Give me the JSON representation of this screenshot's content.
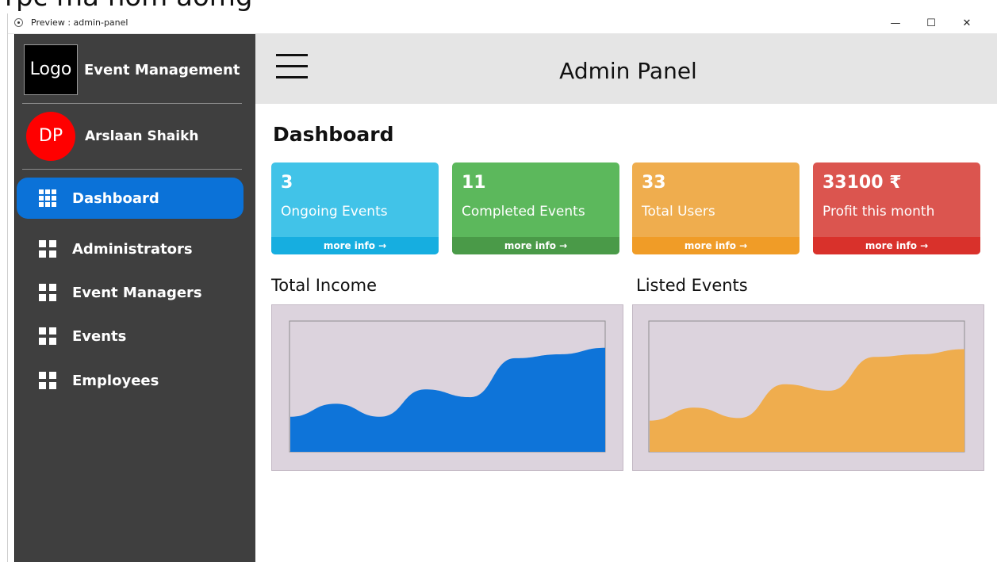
{
  "top_caption": "rpc ma nom aomg",
  "window": {
    "title": "Preview : admin-panel",
    "minimize": "—",
    "maximize": "☐",
    "close": "✕"
  },
  "brand": {
    "logo": "Logo",
    "name": "Event Management"
  },
  "profile": {
    "initials": "DP",
    "name": "Arslaan Shaikh"
  },
  "nav": [
    {
      "label": "Dashboard",
      "icon": "grid-9-icon",
      "active": true
    },
    {
      "label": "Administrators",
      "icon": "grid-4-icon",
      "active": false
    },
    {
      "label": "Event Managers",
      "icon": "grid-4-icon",
      "active": false
    },
    {
      "label": "Events",
      "icon": "grid-4-icon",
      "active": false
    },
    {
      "label": "Employees",
      "icon": "grid-4-icon",
      "active": false
    }
  ],
  "header": {
    "title": "Admin Panel",
    "menu_icon": "hamburger-icon"
  },
  "page": {
    "title": "Dashboard"
  },
  "cards": [
    {
      "value": "3",
      "label": "Ongoing Events",
      "more": "more info",
      "color": "#41c3e8",
      "footer_color": "#16aee0"
    },
    {
      "value": "11",
      "label": "Completed Events",
      "more": "more info",
      "color": "#5cb85c",
      "footer_color": "#4a9a48"
    },
    {
      "value": "33",
      "label": "Total Users",
      "more": "more info",
      "color": "#efad4e",
      "footer_color": "#f09c27"
    },
    {
      "value": "33100 ₹",
      "label": "Profit this month",
      "more": "more info",
      "color": "#db554f",
      "footer_color": "#d9312b"
    }
  ],
  "sections": {
    "income": "Total Income",
    "events": "Listed Events"
  },
  "charts": {
    "income": {
      "fill": "#0e74d9",
      "values": [
        0.27,
        0.37,
        0.27,
        0.48,
        0.42,
        0.72,
        0.75,
        0.8
      ]
    },
    "events": {
      "fill": "#efad4e",
      "values": [
        0.24,
        0.34,
        0.26,
        0.52,
        0.47,
        0.73,
        0.75,
        0.79
      ]
    }
  }
}
